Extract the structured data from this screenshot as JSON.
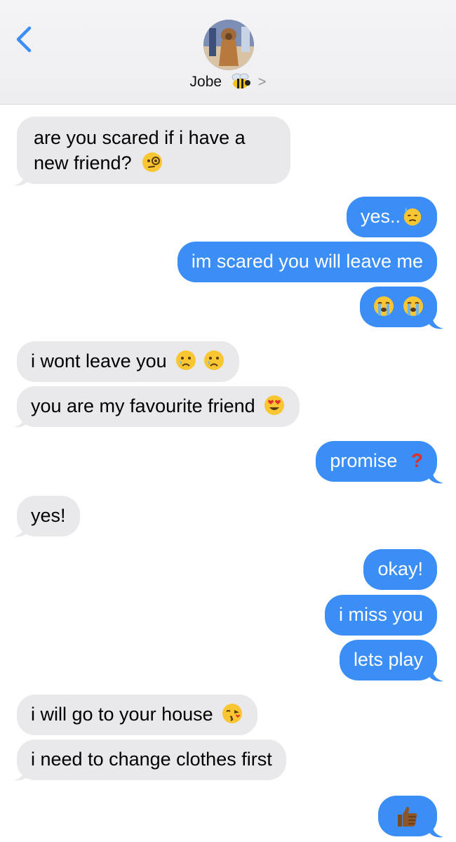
{
  "header": {
    "contact_name": "Jobe",
    "chevron": ">",
    "back_icon": "chevron-left-icon",
    "accent": "#3a8ef5"
  },
  "messages": [
    {
      "side": "in",
      "line1": "are you scared if i have a",
      "line2": "new friend?",
      "emoji": "monocle-face"
    },
    {
      "side": "out",
      "text": "yes..",
      "emoji": "downcast-sweat-face"
    },
    {
      "side": "out",
      "text": "im scared you will leave me"
    },
    {
      "side": "out",
      "text": "",
      "emoji": "loudly-crying-face x2"
    },
    {
      "side": "in",
      "text": "i wont leave you",
      "emoji": "crying-face x2"
    },
    {
      "side": "in",
      "text": "you are my favourite friend",
      "emoji": "heart-eyes-face"
    },
    {
      "side": "out",
      "text": "promise",
      "emoji": "red-question-mark",
      "q": "?"
    },
    {
      "side": "in",
      "text": "yes!"
    },
    {
      "side": "out",
      "text": "okay!"
    },
    {
      "side": "out",
      "text": "i miss you"
    },
    {
      "side": "out",
      "text": "lets play"
    },
    {
      "side": "in",
      "text": "i will go to your house",
      "emoji": "face-blowing-kiss"
    },
    {
      "side": "in",
      "text": "i need to change clothes first"
    },
    {
      "side": "out",
      "text": "",
      "emoji": "thumbs-up-dark-skin"
    }
  ],
  "colors": {
    "incoming": "#e9e9eb",
    "outgoing": "#3a8ef5"
  }
}
